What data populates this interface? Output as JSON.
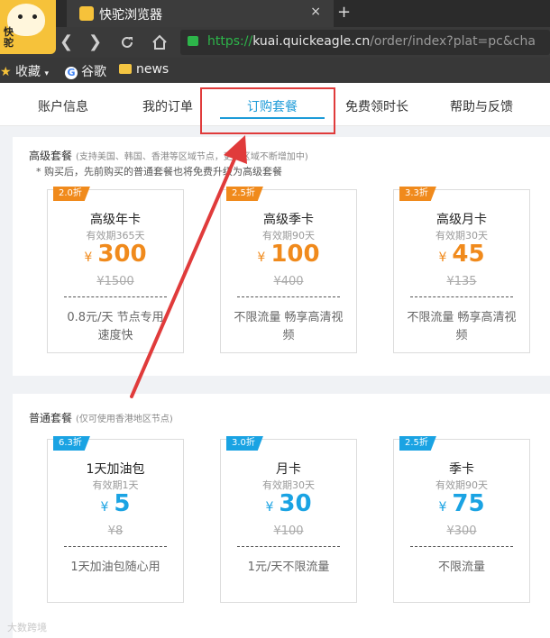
{
  "browser": {
    "logo_text": "快驼",
    "tab_title": "快驼浏览器",
    "tab_close": "×",
    "new_tab": "+",
    "url_scheme": "https://",
    "url_host": "kuai.quickeagle.cn",
    "url_path": "/order/index?plat=pc&cha"
  },
  "bookmarks": [
    {
      "label": "收藏",
      "icon": "star-icon",
      "has_caret": true
    },
    {
      "label": "谷歌",
      "icon": "google-icon"
    },
    {
      "label": "news",
      "icon": "folder-icon"
    }
  ],
  "nav_tabs": [
    "账户信息",
    "我的订单",
    "订购套餐",
    "免费领时长",
    "帮助与反馈"
  ],
  "active_tab": "订购套餐",
  "premium": {
    "title": "高级套餐",
    "subtitle": "(支持美国、韩国、香港等区域节点，更多区域不断增加中)",
    "note": "* 购买后，先前购买的普通套餐也将免费升级为高级套餐",
    "cards": [
      {
        "badge": "2.0折",
        "name": "高级年卡",
        "valid": "有效期365天",
        "currency": "¥",
        "price": "300",
        "original": "¥1500",
        "desc": "0.8元/天 节点专用 速度快"
      },
      {
        "badge": "2.5折",
        "name": "高级季卡",
        "valid": "有效期90天",
        "currency": "¥",
        "price": "100",
        "original": "¥400",
        "desc": "不限流量 畅享高清视频"
      },
      {
        "badge": "3.3折",
        "name": "高级月卡",
        "valid": "有效期30天",
        "currency": "¥",
        "price": "45",
        "original": "¥135",
        "desc": "不限流量 畅享高清视频"
      }
    ]
  },
  "regular": {
    "title": "普通套餐",
    "subtitle": "(仅可使用香港地区节点)",
    "cards": [
      {
        "badge": "6.3折",
        "name": "1天加油包",
        "valid": "有效期1天",
        "currency": "¥",
        "price": "5",
        "original": "¥8",
        "desc": "1天加油包随心用"
      },
      {
        "badge": "3.0折",
        "name": "月卡",
        "valid": "有效期30天",
        "currency": "¥",
        "price": "30",
        "original": "¥100",
        "desc": "1元/天不限流量"
      },
      {
        "badge": "2.5折",
        "name": "季卡",
        "valid": "有效期90天",
        "currency": "¥",
        "price": "75",
        "original": "¥300",
        "desc": "不限流量"
      }
    ]
  },
  "watermark": "大数跨境",
  "colors": {
    "accent": "#1d9bd8",
    "premium": "#f08a1c",
    "regular": "#1aa3e3",
    "annotation": "#e03b3b"
  }
}
